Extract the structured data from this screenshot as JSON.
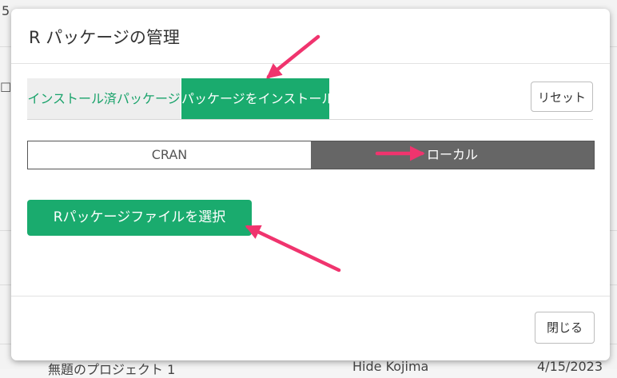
{
  "background": {
    "top_left_text": "5",
    "bottom_project": "無題のプロジェクト 1",
    "bottom_owner": "Hide Kojima",
    "bottom_date": "4/15/2023"
  },
  "dialog": {
    "title": "R パッケージの管理",
    "tabs": [
      {
        "label": "インストール済パッケージ",
        "active": false
      },
      {
        "label": "パッケージをインストール",
        "active": true
      }
    ],
    "reset_label": "リセット",
    "source_options": [
      {
        "label": "CRAN",
        "selected": false
      },
      {
        "label": "ローカル",
        "selected": true
      }
    ],
    "choose_file_label": "Rパッケージファイルを選択",
    "close_label": "閉じる"
  },
  "colors": {
    "accent_green": "#1aab6e",
    "selected_segment": "#666666",
    "annotation_arrow": "#f0346e"
  }
}
